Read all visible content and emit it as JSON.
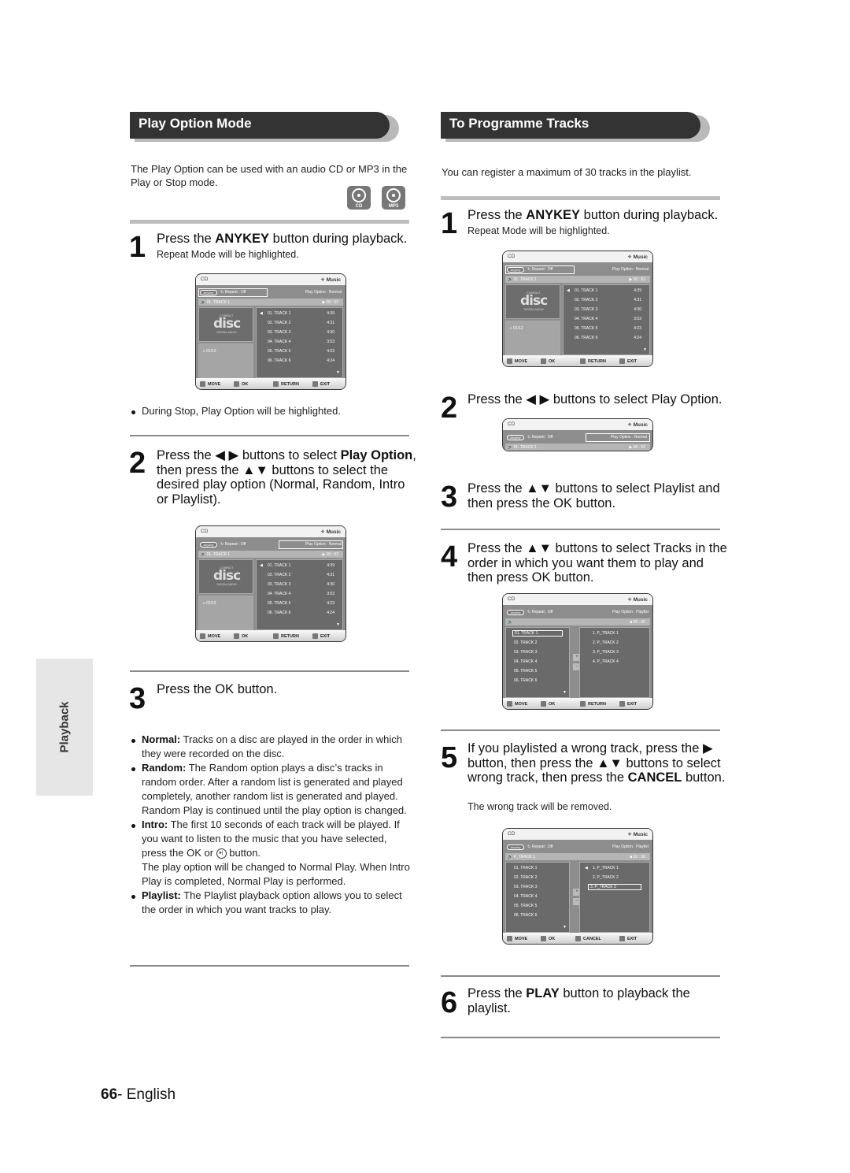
{
  "side_tab": "Playback",
  "footer": {
    "page_number": "66",
    "separator": "-",
    "language": "English"
  },
  "left": {
    "title": "Play Option Mode",
    "intro": "The Play Option can be used with an audio CD or MP3 in the Play or Stop mode.",
    "badges": [
      {
        "icon": "cd-disc-icon",
        "label": "CD"
      },
      {
        "icon": "mp3-disc-icon",
        "label": "MP3"
      }
    ],
    "step1": {
      "num": "1",
      "pre": "Press the ",
      "bold": "ANYKEY",
      "post": " button during playback.",
      "sub": "Repeat Mode will be highlighted."
    },
    "note_stop": "During Stop, Play Option will be highlighted.",
    "step2": {
      "num": "2",
      "pre": "Press the ◀ ▶ buttons to select ",
      "bold": "Play Option",
      "post": ", then press the ▲▼ buttons to select the desired play option (Normal, Random, Intro or Playlist)."
    },
    "step3": {
      "num": "3",
      "text": "Press the OK button."
    },
    "options": [
      {
        "term": "Normal:",
        "desc": " Tracks on a disc are played in the order in which they were recorded on the disc."
      },
      {
        "term": "Random:",
        "desc": " The Random option plays a disc’s tracks in random order. After a random list is generated and played completely, another random list is generated and played. Random Play is continued until the play option is changed."
      },
      {
        "term": "Intro:",
        "desc": " The first 10 seconds of each track will be played. If you want to listen to the music that you have selected, press the OK or",
        "desc2": " button.",
        "desc3": "The play option will be changed to Normal Play. When Intro Play is completed, Normal Play is performed."
      },
      {
        "term": "Playlist:",
        "desc": " The Playlist playback option allows you to select the order in which you want tracks to play."
      }
    ]
  },
  "right": {
    "title": "To Programme Tracks",
    "intro": "You can register a maximum of 30 tracks in the playlist.",
    "step1": {
      "num": "1",
      "pre": "Press the ",
      "bold": "ANYKEY",
      "post": " button during playback.",
      "sub": "Repeat Mode will be highlighted."
    },
    "step2": {
      "num": "2",
      "text": "Press the ◀ ▶ buttons to select Play Option."
    },
    "step3": {
      "num": "3",
      "text": "Press the ▲▼ buttons to select Playlist and then press the OK button."
    },
    "step4": {
      "num": "4",
      "text": "Press the ▲▼ buttons to select Tracks in the order in which you want them to play and then press OK button."
    },
    "step5": {
      "num": "5",
      "pre": "If you playlisted a wrong track, press the ▶ button, then press the ▲▼ buttons to select wrong track, then press the ",
      "bold": "CANCEL",
      "post": " button.",
      "sub": "The wrong track will be removed."
    },
    "step6": {
      "num": "6",
      "pre": "Press the ",
      "bold": "PLAY",
      "post": " button to playback the playlist."
    }
  },
  "osd": {
    "source": "CD",
    "mode": "✧ Music",
    "anykey": "Anykey",
    "repeat": "↻ Repeat : Off",
    "play_option_normal": "Play Option : Normal",
    "play_option_playlist": "Play Option : Playlist",
    "now_playing": "🔉 01. TRACK 1",
    "now_playing_p": "🔉 P_TRACK 1",
    "now_empty": "🔉",
    "time": "▶  00 : 52",
    "time_stop": "■  00 : 00",
    "time_p": "■  01 : 36",
    "disc_logo": "disc",
    "disc_top": "COMPACT",
    "disc_bottom": "DIGITAL AUDIO",
    "count": "♫ 01/12",
    "tracks": [
      {
        "name": "01. TRACK 1",
        "dur": "4:39"
      },
      {
        "name": "02. TRACK 2",
        "dur": "4:31"
      },
      {
        "name": "03. TRACK 3",
        "dur": "4:30"
      },
      {
        "name": "04. TRACK 4",
        "dur": "3:53"
      },
      {
        "name": "05. TRACK 5",
        "dur": "4:23"
      },
      {
        "name": "06. TRACK 6",
        "dur": "4:24"
      }
    ],
    "playlist4": [
      "1. P_TRACK 1",
      "2. P_TRACK 2",
      "3. P_TRACK 3",
      "4. P_TRACK 4"
    ],
    "playlist3": [
      "1. P_TRACK 1",
      "2. P_TRACK 2",
      "3. P_TRACK 3"
    ],
    "foot": {
      "move": "MOVE",
      "ok": "OK",
      "return": "RETURN",
      "exit": "EXIT",
      "cancel": "CANCEL"
    }
  }
}
